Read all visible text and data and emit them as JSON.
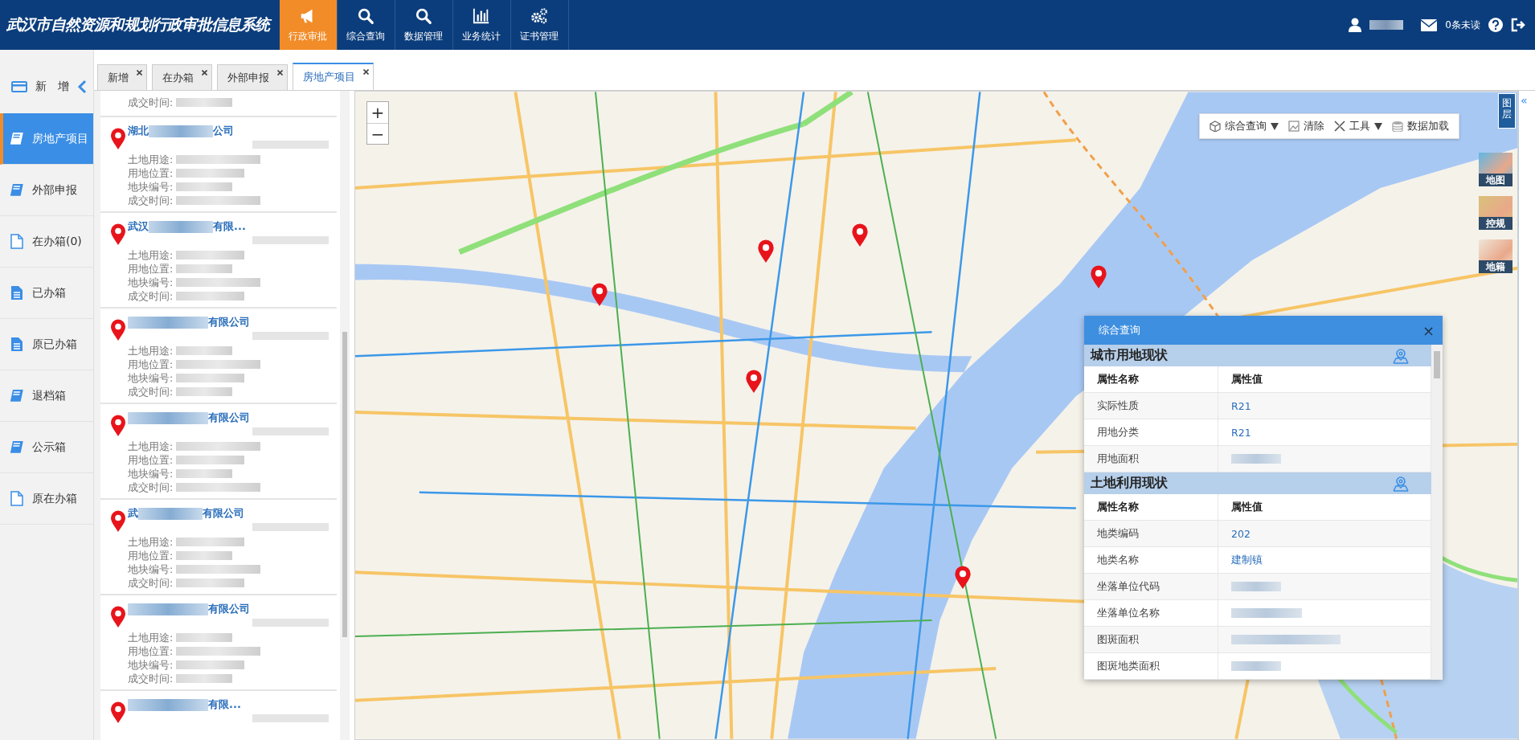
{
  "header": {
    "title": "武汉市自然资源和规划行政审批信息系统",
    "nav": [
      {
        "label": "行政审批",
        "selected": true
      },
      {
        "label": "综合查询",
        "selected": false
      },
      {
        "label": "数据管理",
        "selected": false
      },
      {
        "label": "业务统计",
        "selected": false
      },
      {
        "label": "证书管理",
        "selected": false
      }
    ],
    "messages": "0条未读"
  },
  "sidebar": {
    "new_label": "新　增",
    "items": [
      {
        "label": "房地产项目",
        "selected": true
      },
      {
        "label": "外部申报",
        "selected": false
      },
      {
        "label": "在办箱(0)",
        "selected": false
      },
      {
        "label": "已办箱",
        "selected": false
      },
      {
        "label": "原已办箱",
        "selected": false
      },
      {
        "label": "退档箱",
        "selected": false
      },
      {
        "label": "公示箱",
        "selected": false
      },
      {
        "label": "原在办箱",
        "selected": false
      }
    ]
  },
  "tabs": [
    {
      "label": "新增",
      "selected": false
    },
    {
      "label": "在办箱",
      "selected": false
    },
    {
      "label": "外部申报",
      "selected": false
    },
    {
      "label": "房地产项目",
      "selected": true
    }
  ],
  "project_list": {
    "items": [
      {
        "fields": [
          {
            "label": "成交时间:"
          }
        ]
      },
      {
        "name_start": "湖北",
        "name_end": "公司",
        "fields": [
          {
            "label": "土地用途:"
          },
          {
            "label": "用地位置:"
          },
          {
            "label": "地块编号:"
          },
          {
            "label": "成交时间:"
          }
        ]
      },
      {
        "name_start": "武汉",
        "name_end": "有限...",
        "fields": [
          {
            "label": "土地用途:"
          },
          {
            "label": "用地位置:"
          },
          {
            "label": "地块编号:"
          },
          {
            "label": "成交时间:"
          }
        ]
      },
      {
        "name_end": "有限公司",
        "fields": [
          {
            "label": "土地用途:"
          },
          {
            "label": "用地位置:"
          },
          {
            "label": "地块编号:"
          },
          {
            "label": "成交时间:"
          }
        ]
      },
      {
        "name_end": "有限公司",
        "fields": [
          {
            "label": "土地用途:"
          },
          {
            "label": "用地位置:"
          },
          {
            "label": "地块编号:"
          },
          {
            "label": "成交时间:"
          }
        ]
      },
      {
        "name_start": "武",
        "name_end": "有限公司",
        "fields": [
          {
            "label": "土地用途:"
          },
          {
            "label": "用地位置:"
          },
          {
            "label": "地块编号:"
          },
          {
            "label": "成交时间:"
          }
        ]
      },
      {
        "name_end": "有限公司",
        "fields": [
          {
            "label": "土地用途:"
          },
          {
            "label": "用地位置:"
          },
          {
            "label": "地块编号:"
          },
          {
            "label": "成交时间:"
          }
        ]
      },
      {
        "name_end": "有限..."
      }
    ]
  },
  "map": {
    "zoom_in": "+",
    "zoom_out": "−",
    "toolbar": [
      {
        "label": "综合查询",
        "dropdown": true
      },
      {
        "label": "清除",
        "dropdown": false
      },
      {
        "label": "工具",
        "dropdown": true
      },
      {
        "label": "数据加载",
        "dropdown": false
      }
    ],
    "layers_tab": "图层",
    "basemaps": [
      {
        "label": "地图"
      },
      {
        "label": "控规"
      },
      {
        "label": "地籍"
      }
    ],
    "collapse": "«"
  },
  "query_popup": {
    "title": "综合查询",
    "close": "×",
    "sections": [
      {
        "title": "城市用地现状",
        "columns": [
          "属性名称",
          "属性值"
        ],
        "rows": [
          {
            "name": "实际性质",
            "value": "R21"
          },
          {
            "name": "用地分类",
            "value": "R21"
          },
          {
            "name": "用地面积"
          }
        ]
      },
      {
        "title": "土地利用现状",
        "columns": [
          "属性名称",
          "属性值"
        ],
        "rows": [
          {
            "name": "地类编码",
            "value": "202"
          },
          {
            "name": "地类名称",
            "value": "建制镇"
          },
          {
            "name": "坐落单位代码"
          },
          {
            "name": "坐落单位名称"
          },
          {
            "name": "图斑面积"
          },
          {
            "name": "图斑地类面积"
          }
        ]
      }
    ]
  }
}
